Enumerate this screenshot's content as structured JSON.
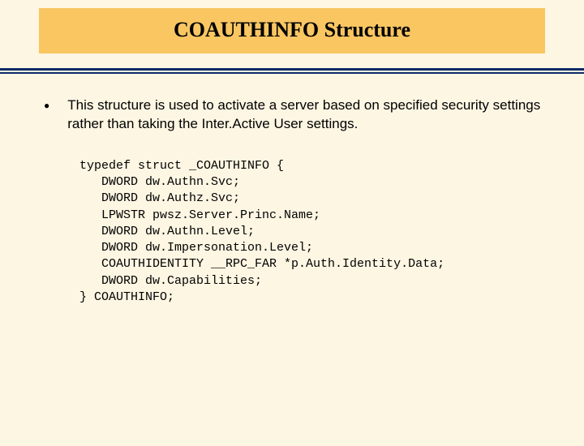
{
  "title": "COAUTHINFO Structure",
  "bullet_text": "This structure is used to activate a server based on specified security settings rather than taking the Inter.Active User settings.",
  "code": "typedef struct _COAUTHINFO {\n   DWORD dw.Authn.Svc;\n   DWORD dw.Authz.Svc;\n   LPWSTR pwsz.Server.Princ.Name;\n   DWORD dw.Authn.Level;\n   DWORD dw.Impersonation.Level;\n   COAUTHIDENTITY __RPC_FAR *p.Auth.Identity.Data;\n   DWORD dw.Capabilities;\n} COAUTHINFO;"
}
